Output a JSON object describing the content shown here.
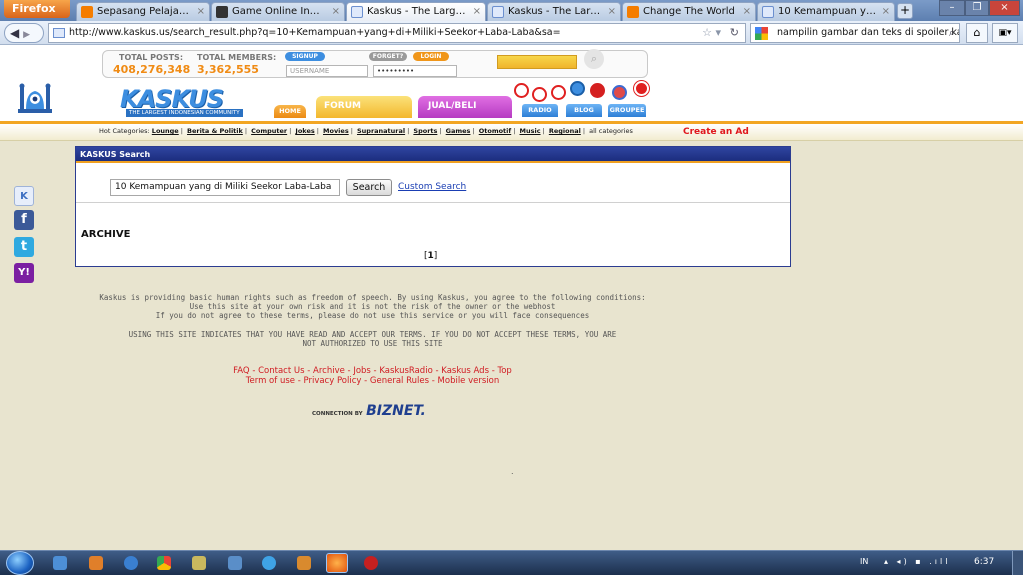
{
  "browser": {
    "app_button": "Firefox",
    "tabs": [
      {
        "label": "Sepasang Pelajar Tertan...",
        "icon_color": "#f57d00"
      },
      {
        "label": "Game Online Indonesia |...",
        "icon_color": "#333333"
      },
      {
        "label": "Kaskus - The Largest Ind...",
        "icon_color": "#6b8fcf"
      },
      {
        "label": "Kaskus - The Largest Ind...",
        "icon_color": "#6b8fcf"
      },
      {
        "label": "Change The World",
        "icon_color": "#f57d00"
      },
      {
        "label": "10 Kemampuan yang di ...",
        "icon_color": "#6b8fcf"
      }
    ],
    "url": "http://www.kaskus.us/search_result.php?q=10+Kemampuan+yang+di+Miliki+Seekor+Laba-Laba&sa=",
    "search_value": "nampilin gambar dan teks di spoiler kaskus"
  },
  "header": {
    "total_posts_label": "TOTAL POSTS:",
    "total_posts_value": "408,276,348",
    "total_members_label": "TOTAL MEMBERS:",
    "total_members_value": "3,362,555",
    "signup_label": "SIGNUP",
    "forget_label": "FORGET?",
    "login_label": "LOGIN",
    "username_placeholder": "USERNAME",
    "password_value": "•••••••••",
    "logo_text": "KASKUS",
    "logo_tagline": "THE LARGEST INDONESIAN COMMUNITY",
    "nav": {
      "home": "HOME",
      "forum": "FORUM",
      "jual_beli": "JUAL/BELI"
    },
    "bottom_buttons": {
      "radio": "RADIO",
      "blog": "BLOG",
      "groupee": "GROUPEE"
    }
  },
  "hotbar": {
    "prefix": "Hot Categories:",
    "categories": [
      "Lounge",
      "Berita & Politik",
      "Computer",
      "Jokes",
      "Movies",
      "Supranatural",
      "Sports",
      "Games",
      "Otomotif",
      "Music",
      "Regional"
    ],
    "all_label": "all categories",
    "create_ad": "Create an Ad"
  },
  "search": {
    "panel_title": "KASKUS Search",
    "query": "10 Kemampuan yang di Miliki Seekor Laba-Laba",
    "button_label": "Search",
    "custom_search_label": "Custom Search",
    "archive_title": "ARCHIVE",
    "pager_current": "1"
  },
  "footer": {
    "line1": "Kaskus is providing basic human rights such as freedom of speech. By using Kaskus, you agree to the following conditions:",
    "line2": "Use this site at your own risk and it is not the risk of the owner or the webhost",
    "line3": "If you do not agree to these terms, please do not use this service or you will face consequences",
    "line4": "USING THIS SITE INDICATES THAT YOU HAVE READ AND ACCEPT OUR TERMS. IF YOU DO NOT ACCEPT THESE TERMS, YOU ARE",
    "line5": "NOT AUTHORIZED TO USE THIS SITE",
    "links_row1": [
      "FAQ",
      "Contact Us",
      "Archive",
      "Jobs",
      "KaskusRadio",
      "Kaskus Ads",
      "Top"
    ],
    "links_row2": [
      "Term of use",
      "Privacy Policy",
      "General Rules",
      "Mobile version"
    ],
    "connection_label": "CONNECTION BY",
    "connection_brand": "BIZNET."
  },
  "taskbar": {
    "lang": "IN",
    "clock": "6:37"
  },
  "colors": {
    "accent_orange": "#f2a624",
    "panel_blue": "#2b3c91",
    "link_red": "#d01b22"
  }
}
